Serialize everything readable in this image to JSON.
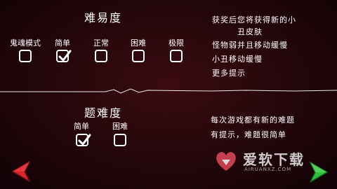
{
  "difficulty": {
    "title": "难易度",
    "options": [
      {
        "label": "鬼魂模式",
        "checked": false
      },
      {
        "label": "简单",
        "checked": true
      },
      {
        "label": "正常",
        "checked": false
      },
      {
        "label": "困难",
        "checked": false
      },
      {
        "label": "极限",
        "checked": false
      }
    ],
    "info": {
      "line1": "获奖后您将获得新的小",
      "line2": "丑皮肤",
      "line3": "怪物弱并且移动缓慢",
      "line4": "小丑移动缓慢",
      "line5": "更多提示"
    }
  },
  "question_difficulty": {
    "title": "题难度",
    "options": [
      {
        "label": "简单",
        "checked": true
      },
      {
        "label": "困难",
        "checked": false
      }
    ],
    "info": {
      "line1": "每次游戏都有新的难题",
      "line2": "有提示，难题很简单"
    }
  },
  "watermark": {
    "brand": "爱软下载",
    "sub": "AIRUANXZ.COM"
  },
  "colors": {
    "accent_back": "#d8262e",
    "accent_next": "#2fbf3a",
    "background": "#22060a"
  },
  "icons": {
    "back": "red-left-arrow-icon",
    "next": "green-right-arrow-icon",
    "check": "check-icon"
  }
}
